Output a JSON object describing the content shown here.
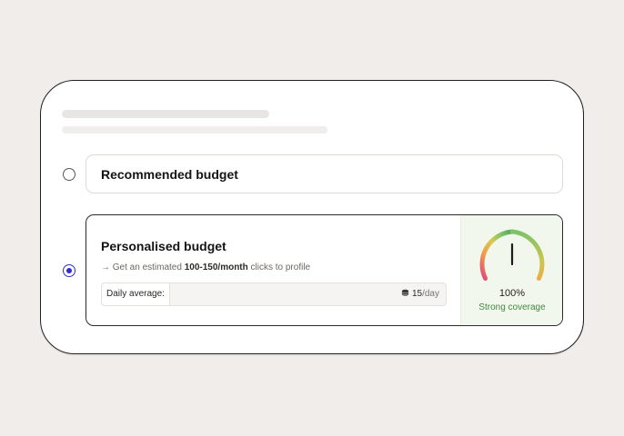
{
  "options": {
    "recommended": {
      "title": "Recommended budget",
      "selected": false
    },
    "personalised": {
      "title": "Personalised budget",
      "selected": true,
      "estimate_prefix": "→ Get an estimated ",
      "estimate_bold": "100-150/month",
      "estimate_suffix": " clicks to profile",
      "daily_label": "Daily average:",
      "daily_value": "15",
      "daily_unit": "/day",
      "daily_icon": "coin-stack-icon"
    }
  },
  "gauge": {
    "percent_label": "100%",
    "coverage_label": "Strong coverage",
    "level": 1.0,
    "colors": [
      "#e0457b",
      "#f0a04b",
      "#e8cf4a",
      "#7cc36a",
      "#4aa84a"
    ]
  }
}
